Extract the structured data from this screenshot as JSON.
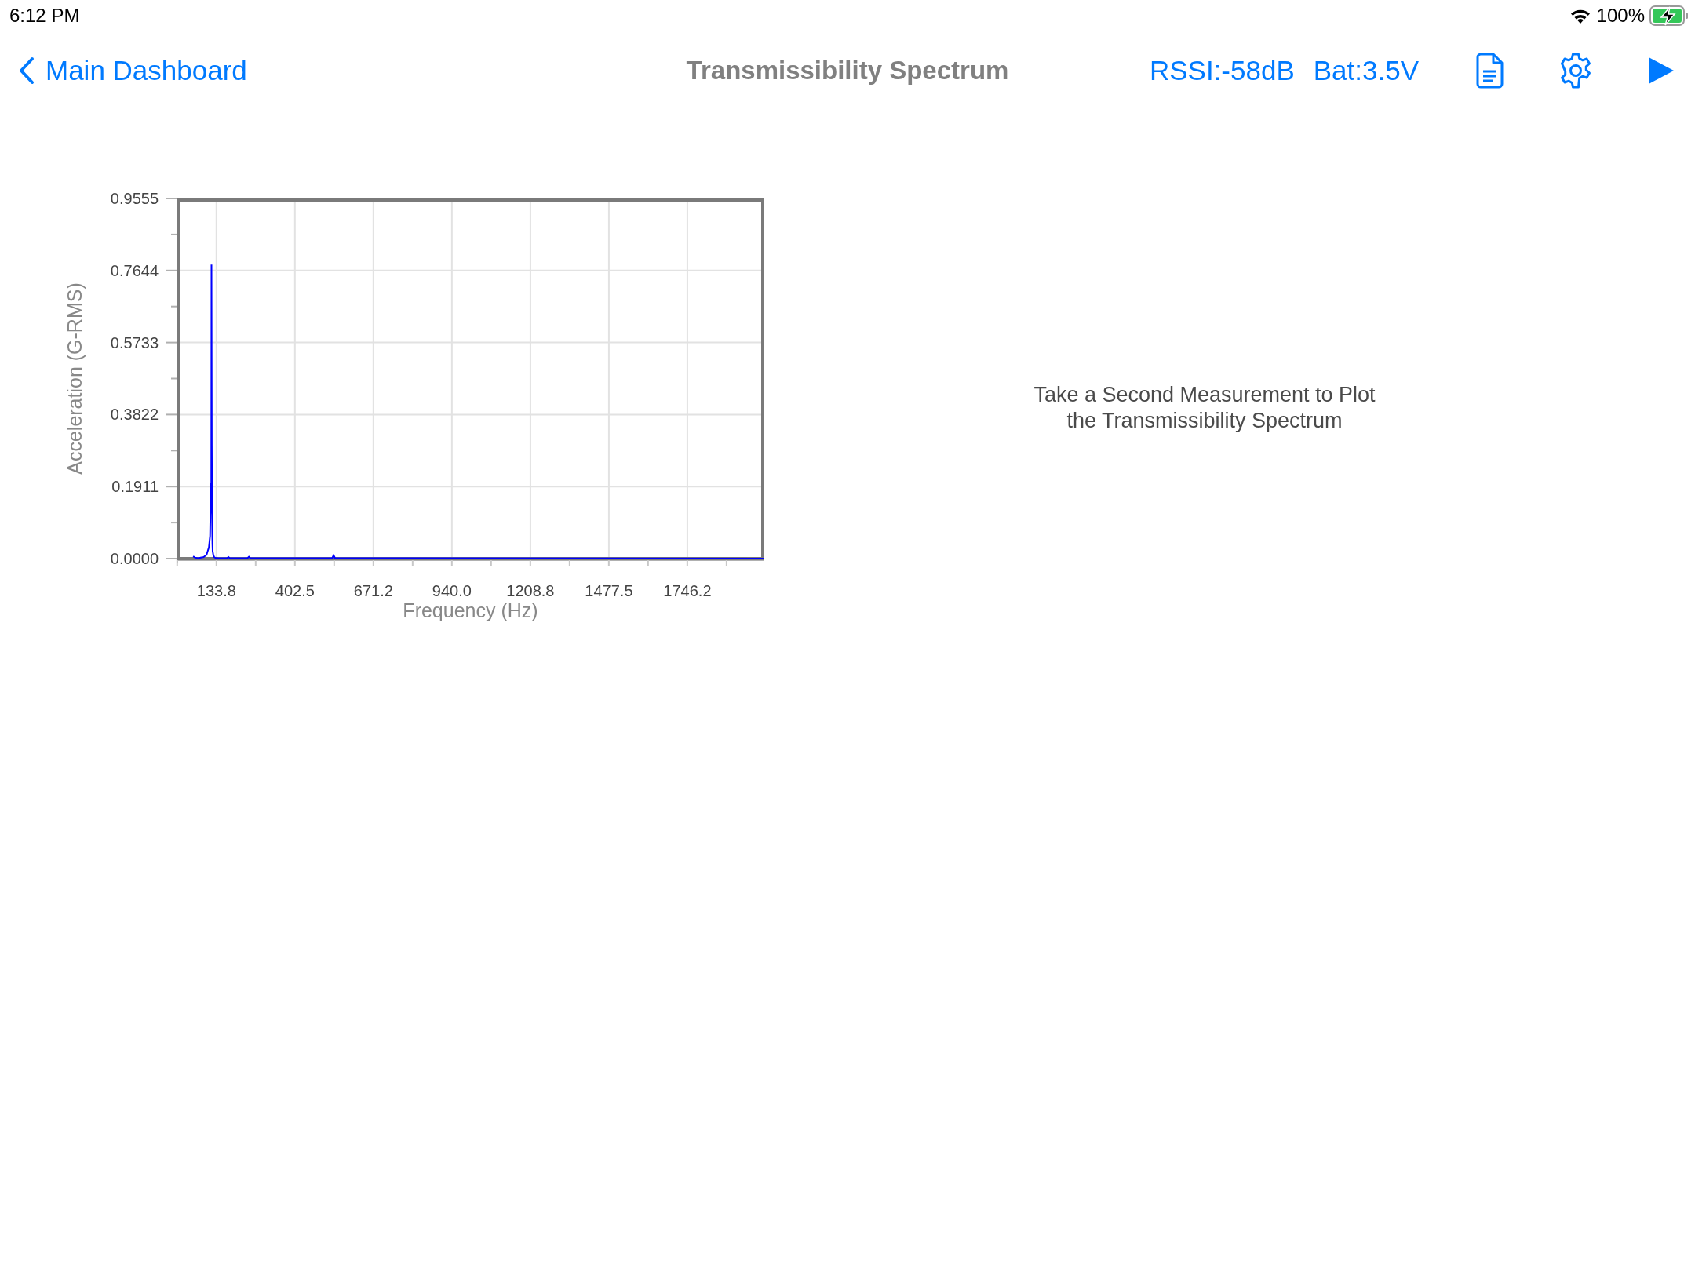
{
  "status_bar": {
    "time": "6:12 PM",
    "battery": "100%",
    "charging": true
  },
  "nav_bar": {
    "back": "Main Dashboard",
    "title": "Transmissibility Spectrum",
    "rssi": "RSSI:-58dB",
    "battery_voltage": "Bat:3.5V"
  },
  "chart": {
    "chart_data": {
      "type": "line",
      "grid": true,
      "xlabel": "Frequency (Hz)",
      "ylabel": "Acceleration (G-RMS)",
      "xlim": [
        0,
        2007
      ],
      "ylim": [
        0,
        0.9555
      ],
      "xticks": [
        {
          "value": 133.8,
          "label": "133.8"
        },
        {
          "value": 402.5,
          "label": "402.5"
        },
        {
          "value": 671.2,
          "label": "671.2"
        },
        {
          "value": 940.0,
          "label": "940.0"
        },
        {
          "value": 1208.8,
          "label": "1208.8"
        },
        {
          "value": 1477.5,
          "label": "1477.5"
        },
        {
          "value": 1746.2,
          "label": "1746.2"
        }
      ],
      "yticks": [
        {
          "value": 0,
          "label": "0.0000"
        },
        {
          "value": 0.1911,
          "label": "0.1911"
        },
        {
          "value": 0.3822,
          "label": "0.3822"
        },
        {
          "value": 0.5733,
          "label": "0.5733"
        },
        {
          "value": 0.7644,
          "label": "0.7644"
        },
        {
          "value": 0.9555,
          "label": "0.9555"
        }
      ],
      "x": [
        54,
        60,
        70,
        90,
        100,
        108,
        112,
        115,
        116,
        117,
        118,
        119,
        120,
        121,
        123,
        126,
        130,
        140,
        170,
        175,
        180,
        240,
        245,
        250,
        530,
        535,
        540,
        600,
        2007
      ],
      "series": [
        {
          "color": "#0000ff",
          "values": [
            0.006,
            0.003,
            0.001,
            0.004,
            0.01,
            0.03,
            0.06,
            0.2,
            0.12,
            0.78,
            0.3,
            0.1,
            0.04,
            0.02,
            0.01,
            0.004,
            0.002,
            0.001,
            0.001,
            0.004,
            0.001,
            0.001,
            0.005,
            0.001,
            0.001,
            0.009,
            0.001,
            0.001,
            0.0
          ]
        }
      ]
    }
  },
  "message": "Take a Second Measurement to Plot the Transmissibility Spectrum"
}
